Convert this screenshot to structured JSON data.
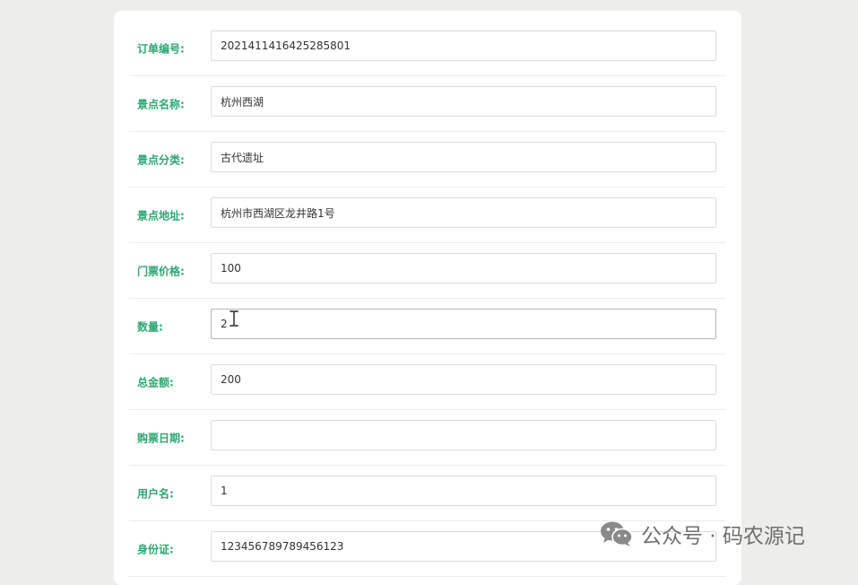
{
  "form": {
    "rows": [
      {
        "label": "订单编号:",
        "value": "2021411416425285801"
      },
      {
        "label": "景点名称:",
        "value": "杭州西湖"
      },
      {
        "label": "景点分类:",
        "value": "古代遗址"
      },
      {
        "label": "景点地址:",
        "value": "杭州市西湖区龙井路1号"
      },
      {
        "label": "门票价格:",
        "value": "100"
      },
      {
        "label": "数量:",
        "value": "2"
      },
      {
        "label": "总金额:",
        "value": "200"
      },
      {
        "label": "购票日期:",
        "value": ""
      },
      {
        "label": "用户名:",
        "value": "1"
      },
      {
        "label": "身份证:",
        "value": "123456789789456123"
      }
    ]
  },
  "watermark": {
    "text": "公众号 · 码农源记",
    "icon": "wechat-icon"
  },
  "colors": {
    "label": "#2aa870",
    "background": "#ededeb"
  }
}
